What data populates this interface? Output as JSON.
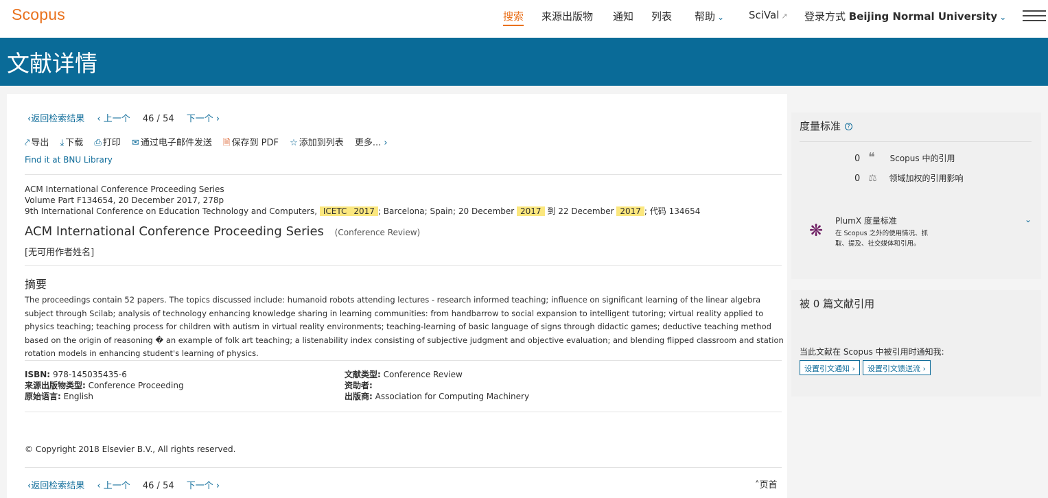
{
  "header": {
    "logo": "Scopus",
    "nav": {
      "search": "搜索",
      "sources": "来源出版物",
      "alerts": "通知",
      "lists": "列表",
      "help": "帮助",
      "scival": "SciVal",
      "login_prefix": "登录方式",
      "institution": "Beijing Normal University"
    }
  },
  "banner": {
    "title": "文献详情"
  },
  "pager": {
    "back": "返回检索结果",
    "prev": "上一个",
    "current": "46",
    "separator": "/",
    "total": "54",
    "next": "下一个",
    "top": "页首"
  },
  "toolbar": {
    "export": "导出",
    "download": "下载",
    "print": "打印",
    "email": "通过电子邮件发送",
    "save_pdf": "保存到 PDF",
    "add_list": "添加到列表",
    "more": "更多..."
  },
  "find_it": "Find it at BNU Library",
  "source": {
    "series": "ACM International Conference Proceeding Series",
    "volume": "Volume Part F134654, 20 December 2017, 278p",
    "conf_prefix": "9th International Conference on Education Technology and Computers,",
    "acronym": "ICETC",
    "year1": "2017",
    "loc_text": "; Barcelona; Spain; 20 December",
    "year2": "2017",
    "to_text": "到 22 December",
    "year3": "2017",
    "code_text": "; 代码 134654"
  },
  "document": {
    "title": "ACM International Conference Proceeding Series",
    "type": "(Conference Review)",
    "authors": "[无可用作者姓名]"
  },
  "abstract": {
    "heading": "摘要",
    "text": "The proceedings contain 52 papers. The topics discussed include: humanoid robots attending lectures - research informed teaching; influence on significant learning of the linear algebra subject through Scilab; analysis of technology enhancing knowledge sharing in learning communities: from handbarrow to social expansion to intelligent tutoring; virtual reality applied to physics teaching; teaching process for children with autism in virtual reality environments; teaching-learning of basic language of signs through didactic games; deductive teaching method based on the origin of reasoning � an example of folk art teaching; a listenability index consisting of subjective judgment and objective evaluation; and blending flipped classroom and station rotation models in enhancing student's learning of physics."
  },
  "info": {
    "isbn_label": "ISBN:",
    "isbn": "978-145035435-6",
    "source_type_label": "来源出版物类型:",
    "source_type": "Conference Proceeding",
    "language_label": "原始语言:",
    "language": "English",
    "doc_type_label": "文献类型:",
    "doc_type": "Conference Review",
    "sponsor_label": "资助者:",
    "publisher_label": "出版商:",
    "publisher": "Association for Computing Machinery"
  },
  "copyright": "© Copyright 2018 Elsevier B.V., All rights reserved.",
  "metrics": {
    "heading": "度量标准",
    "citations_count": "0",
    "citations_label": "Scopus 中的引用",
    "fwci_count": "0",
    "fwci_label": "领域加权的引用影响",
    "plumx_title": "PlumX 度量标准",
    "plumx_desc": "在 Scopus 之外的使用情况、抓取、提及、社交媒体和引用。"
  },
  "cited_by": {
    "heading": "被 0 篇文献引用",
    "note": "当此文献在 Scopus 中被引用时通知我:",
    "alert_button": "设置引文通知 ›",
    "feed_button": "设置引文馈送流 ›"
  },
  "colors": {
    "accent": "#e9711c",
    "banner": "#0a6b98",
    "link": "#0f6c9a",
    "highlight": "#fbe77e"
  }
}
